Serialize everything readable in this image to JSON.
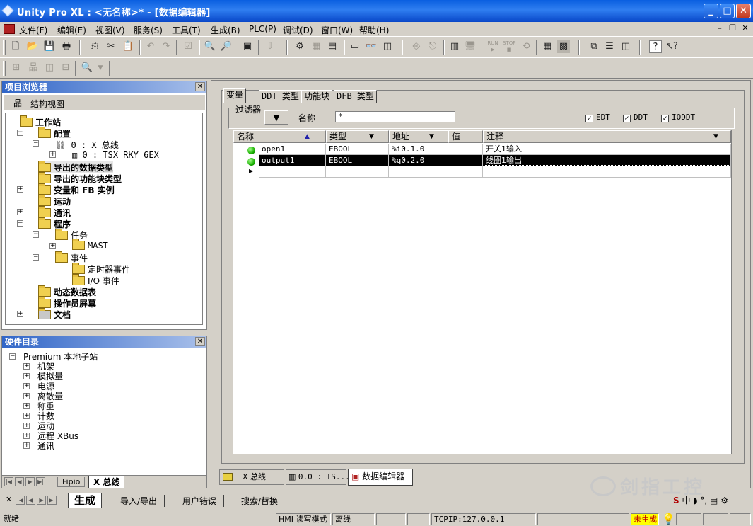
{
  "window": {
    "title": "Unity Pro XL : <无名称>* - [数据编辑器]"
  },
  "menu": [
    "文件(F)",
    "编辑(E)",
    "视图(V)",
    "服务(S)",
    "工具(T)",
    "生成(B)",
    "PLC(P)",
    "调试(D)",
    "窗口(W)",
    "帮助(H)"
  ],
  "toolbar": {
    "run_label": "RUN",
    "stop_label": "STOP"
  },
  "project_browser": {
    "title": "项目浏览器",
    "view": "结构视图",
    "station": "工作站",
    "config": "配置",
    "bus": "0 : X 总线",
    "rack": "0 : TSX RKY 6EX",
    "ddt": "导出的数据类型",
    "dfb": "导出的功能块类型",
    "vars": "变量和 FB 实例",
    "motion": "运动",
    "comm": "通讯",
    "program": "程序",
    "tasks": "任务",
    "mast": "MAST",
    "events": "事件",
    "timer_events": "定时器事件",
    "io_events": "I/O 事件",
    "anim": "动态数据表",
    "screens": "操作员屏幕",
    "docs": "文档"
  },
  "hw_catalog": {
    "title": "硬件目录",
    "root": "Premium 本地子站",
    "items": [
      "机架",
      "模拟量",
      "电源",
      "离散量",
      "称重",
      "计数",
      "运动",
      "远程 XBus",
      "通讯"
    ],
    "tabs": [
      "Fipio",
      "X 总线"
    ]
  },
  "editor": {
    "tabs": [
      "变量",
      "DDT 类型",
      "功能块",
      "DFB 类型"
    ],
    "filter_label": "过滤器",
    "name_label": "名称",
    "name_filter": "*",
    "checks": [
      "EDT",
      "DDT",
      "IODDT"
    ],
    "columns": [
      "名称",
      "类型",
      "地址",
      "值",
      "注释"
    ],
    "rows": [
      {
        "name": "open1",
        "type": "EBOOL",
        "addr": "%i0.1.0",
        "value": "",
        "comment": "开关1输入"
      },
      {
        "name": "output1",
        "type": "EBOOL",
        "addr": "%q0.2.0",
        "value": "",
        "comment": "线圈1输出"
      }
    ]
  },
  "doc_tabs": [
    "X 总线",
    "0.0 : TS...",
    "数据编辑器"
  ],
  "output_tabs": [
    "生成",
    "导入/导出",
    "用户错误",
    "搜索/替换"
  ],
  "watermark": "剑指工控",
  "status": {
    "ready": "就绪",
    "mode": "HMI 读写模式",
    "online": "离线",
    "conn": "TCPIP:127.0.0.1",
    "build": "未生成"
  }
}
